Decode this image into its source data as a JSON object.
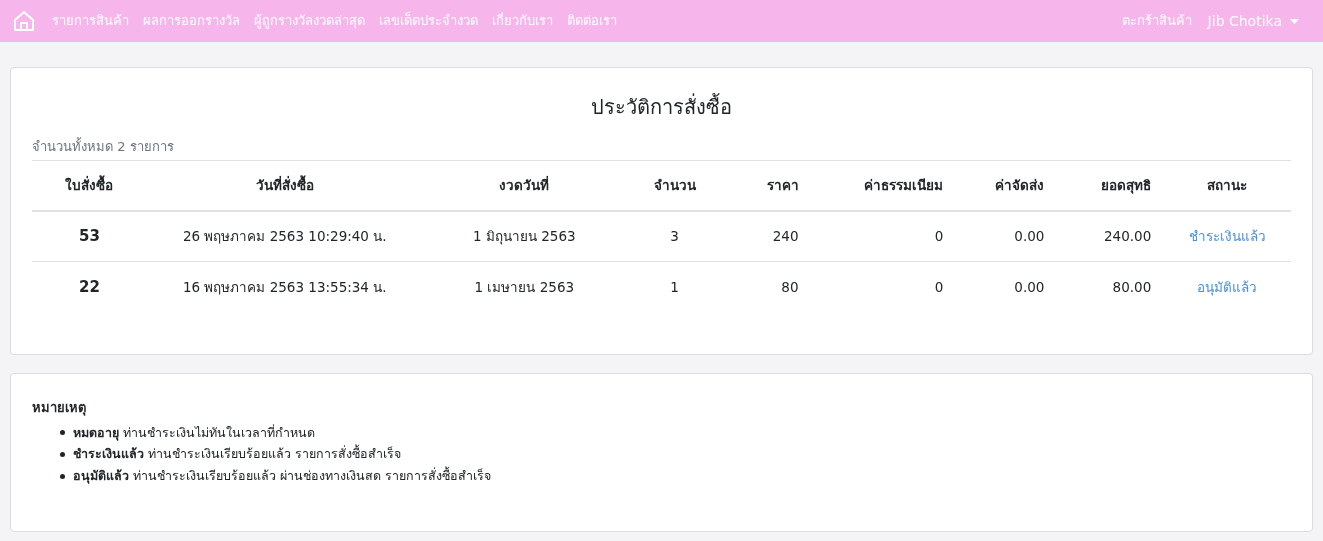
{
  "navbar": {
    "links": [
      "รายการสินค้า",
      "ผลการออกรางวัล",
      "ผู้ถูกรางวัลงวดล่าสุด",
      "เลขเด็ดประจำงวด",
      "เกี่ยวกับเรา",
      "ติดต่อเรา"
    ],
    "cart": "ตะกร้าสินค้า",
    "user": "Jib Chotika"
  },
  "orders": {
    "title": "ประวัติการสั่งซื้อ",
    "total": "จำนวนทั้งหมด 2 รายการ",
    "columns": [
      "ใบสั่งซื้อ",
      "วันที่สั่งซื้อ",
      "งวดวันที่",
      "จำนวน",
      "ราคา",
      "ค่าธรรมเนียม",
      "ค่าจัดส่ง",
      "ยอดสุทธิ",
      "สถานะ"
    ],
    "rows": [
      {
        "cells": [
          "53",
          "26 พฤษภาคม 2563 10:29:40 น.",
          "1 มิถุนายน 2563",
          "3",
          "240",
          "0",
          "0.00",
          "240.00"
        ],
        "status": "ชำระเงินแล้ว"
      },
      {
        "cells": [
          "22",
          "16 พฤษภาคม 2563 13:55:34 น.",
          "1 เมษายน 2563",
          "1",
          "80",
          "0",
          "0.00",
          "80.00"
        ],
        "status": "อนุมัติแล้ว"
      }
    ]
  },
  "notes": {
    "title": "หมายเหตุ",
    "items": [
      "**หมดอายุ** ท่านชำระเงินไม่ทันในเวลาที่กำหนด",
      "**ชำระเงินแล้ว** ท่านชำระเงินเรียบร้อยแล้ว รายการสั่งซื้อสำเร็จ",
      "**อนุมัติแล้ว** ท่านชำระเงินเรียบร้อยแล้ว ผ่านช่องทางเงินสด รายการสั่งซื้อสำเร็จ"
    ]
  }
}
